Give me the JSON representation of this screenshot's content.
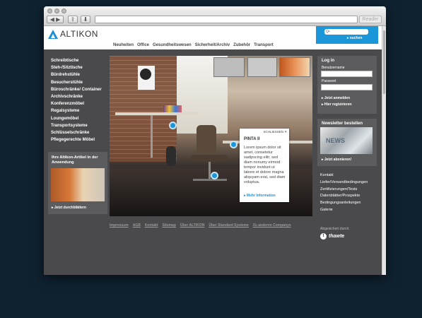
{
  "browser": {
    "reader_label": "Reader"
  },
  "header": {
    "logo_text": "ALTIKON",
    "search_placeholder": "Q•",
    "search_button": "suchen",
    "nav": [
      "Neuheiten",
      "Office",
      "Gesundheitswesen",
      "Sicherheit/Archiv",
      "Zubehör",
      "Transport"
    ]
  },
  "categories": [
    "Schreibtische",
    "Steh-/Sitztische",
    "Bürdrehstühle",
    "Besucherstühle",
    "Büroschränke/ Container",
    "Archivschränke",
    "Konferenzmöbel",
    "Regalsysteme",
    "Loungemöbel",
    "Transportsysteme",
    "Schlüsselschränke",
    "Pflegegerechte Möbel"
  ],
  "promo": {
    "title": "Ihre Altikon-Artikel in der Anwendung",
    "link": "Jetzt durchblättern"
  },
  "popup": {
    "close": "SCHLIESSEN ✕",
    "title": "PINTA II",
    "text": "Lorem ipsum dolor sit amet, consetetur sadipscing elitr, sed diam nonumy eirmod tempor invidunt ut labore et dolore magna aliquyam erat, sed diam voluptua.",
    "link": "Mehr Information"
  },
  "footer_links": [
    "Impressum",
    "AGB",
    "Kontakt",
    "Sitemap",
    "Über ALTIKON",
    "Über Standard Systeme",
    "Zu anderen Companys"
  ],
  "login": {
    "title": "Log in",
    "user_label": "Benutzername",
    "pass_label": "Passwort",
    "login_link": "Jetzt anmelden",
    "register_link": "Hier registrieren"
  },
  "newsletter": {
    "title": "Newsletter bestellen",
    "image_word": "NEWS",
    "link": "Jetzt abonieren!"
  },
  "side_links": [
    "Kontakt",
    "Liefer/Versandbedingungen",
    "Zertifizierungen/Tests",
    "Datenblätter/Prospekte",
    "Bedingungsanleitungen",
    "Galerie"
  ],
  "security": {
    "label": "Abgesichert durch:",
    "brand": "thawte"
  }
}
